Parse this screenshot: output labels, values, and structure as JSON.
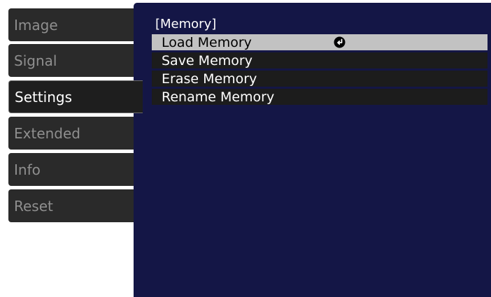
{
  "tabs": [
    {
      "label": "Image"
    },
    {
      "label": "Signal"
    },
    {
      "label": "Settings"
    },
    {
      "label": "Extended"
    },
    {
      "label": "Info"
    },
    {
      "label": "Reset"
    }
  ],
  "active_tab": "Settings",
  "panel": {
    "title": "[Memory]",
    "items": [
      {
        "label": "Load Memory"
      },
      {
        "label": "Save Memory"
      },
      {
        "label": "Erase Memory"
      },
      {
        "label": "Rename Memory"
      }
    ],
    "selected_item": "Load Memory",
    "selected_item_icon": "enter-icon"
  },
  "colors": {
    "panel_background": "#141646",
    "tab_background": "#2a2a2a",
    "tab_inactive_text": "#8f8f8f",
    "selected_row": "#c2c2c2"
  }
}
